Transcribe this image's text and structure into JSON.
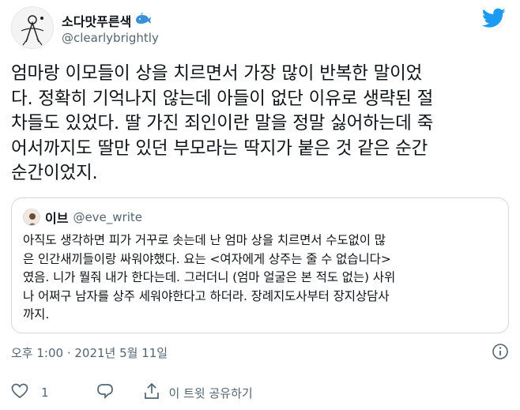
{
  "author": {
    "display_name": "소다맛푸른색",
    "handle": "@clearlybrightly"
  },
  "tweet": {
    "text": "엄마랑 이모들이 상을 치르면서 가장 많이 반복한 말이었\n다. 정확히 기억나지 않는데 아들이 없단 이유로 생략된 절\n차들도 있었다. 딸 가진 죄인이란 말을 정말 싫어하는데 죽\n어서까지도 딸만 있던 부모라는 딱지가 붙은 것 같은 순간\n순간이었지."
  },
  "quoted_tweet": {
    "display_name": "이브",
    "handle": "@eve_write",
    "text": "아직도 생각하면 피가 거꾸로 솟는데 난 엄마 상을 치르면서 수도없이 많\n은 인간새끼들이랑 싸워야했다. 요는 <여자에게 상주는 줄 수 없습니다>\n였음. 니가 뭘줘 내가 한다는데. 그러더니 (엄마 얼굴은 본 적도 없는) 사위\n나 어쩌구 남자를 상주 세워야한다고 하더라. 장례지도사부터 장지상담사\n까지."
  },
  "meta": {
    "timestamp": "오후 1:00 · 2021년 5월 11일"
  },
  "actions": {
    "like_count": "1",
    "share_label": "이 트윗 공유하기"
  },
  "colors": {
    "twitter_blue": "#1d9bf0",
    "text_primary": "#0f1419",
    "text_secondary": "#536471",
    "border": "#cfd9de"
  },
  "icons": [
    "twitter-logo",
    "whale-emoji",
    "info-icon",
    "heart-icon",
    "reply-icon",
    "share-icon"
  ]
}
